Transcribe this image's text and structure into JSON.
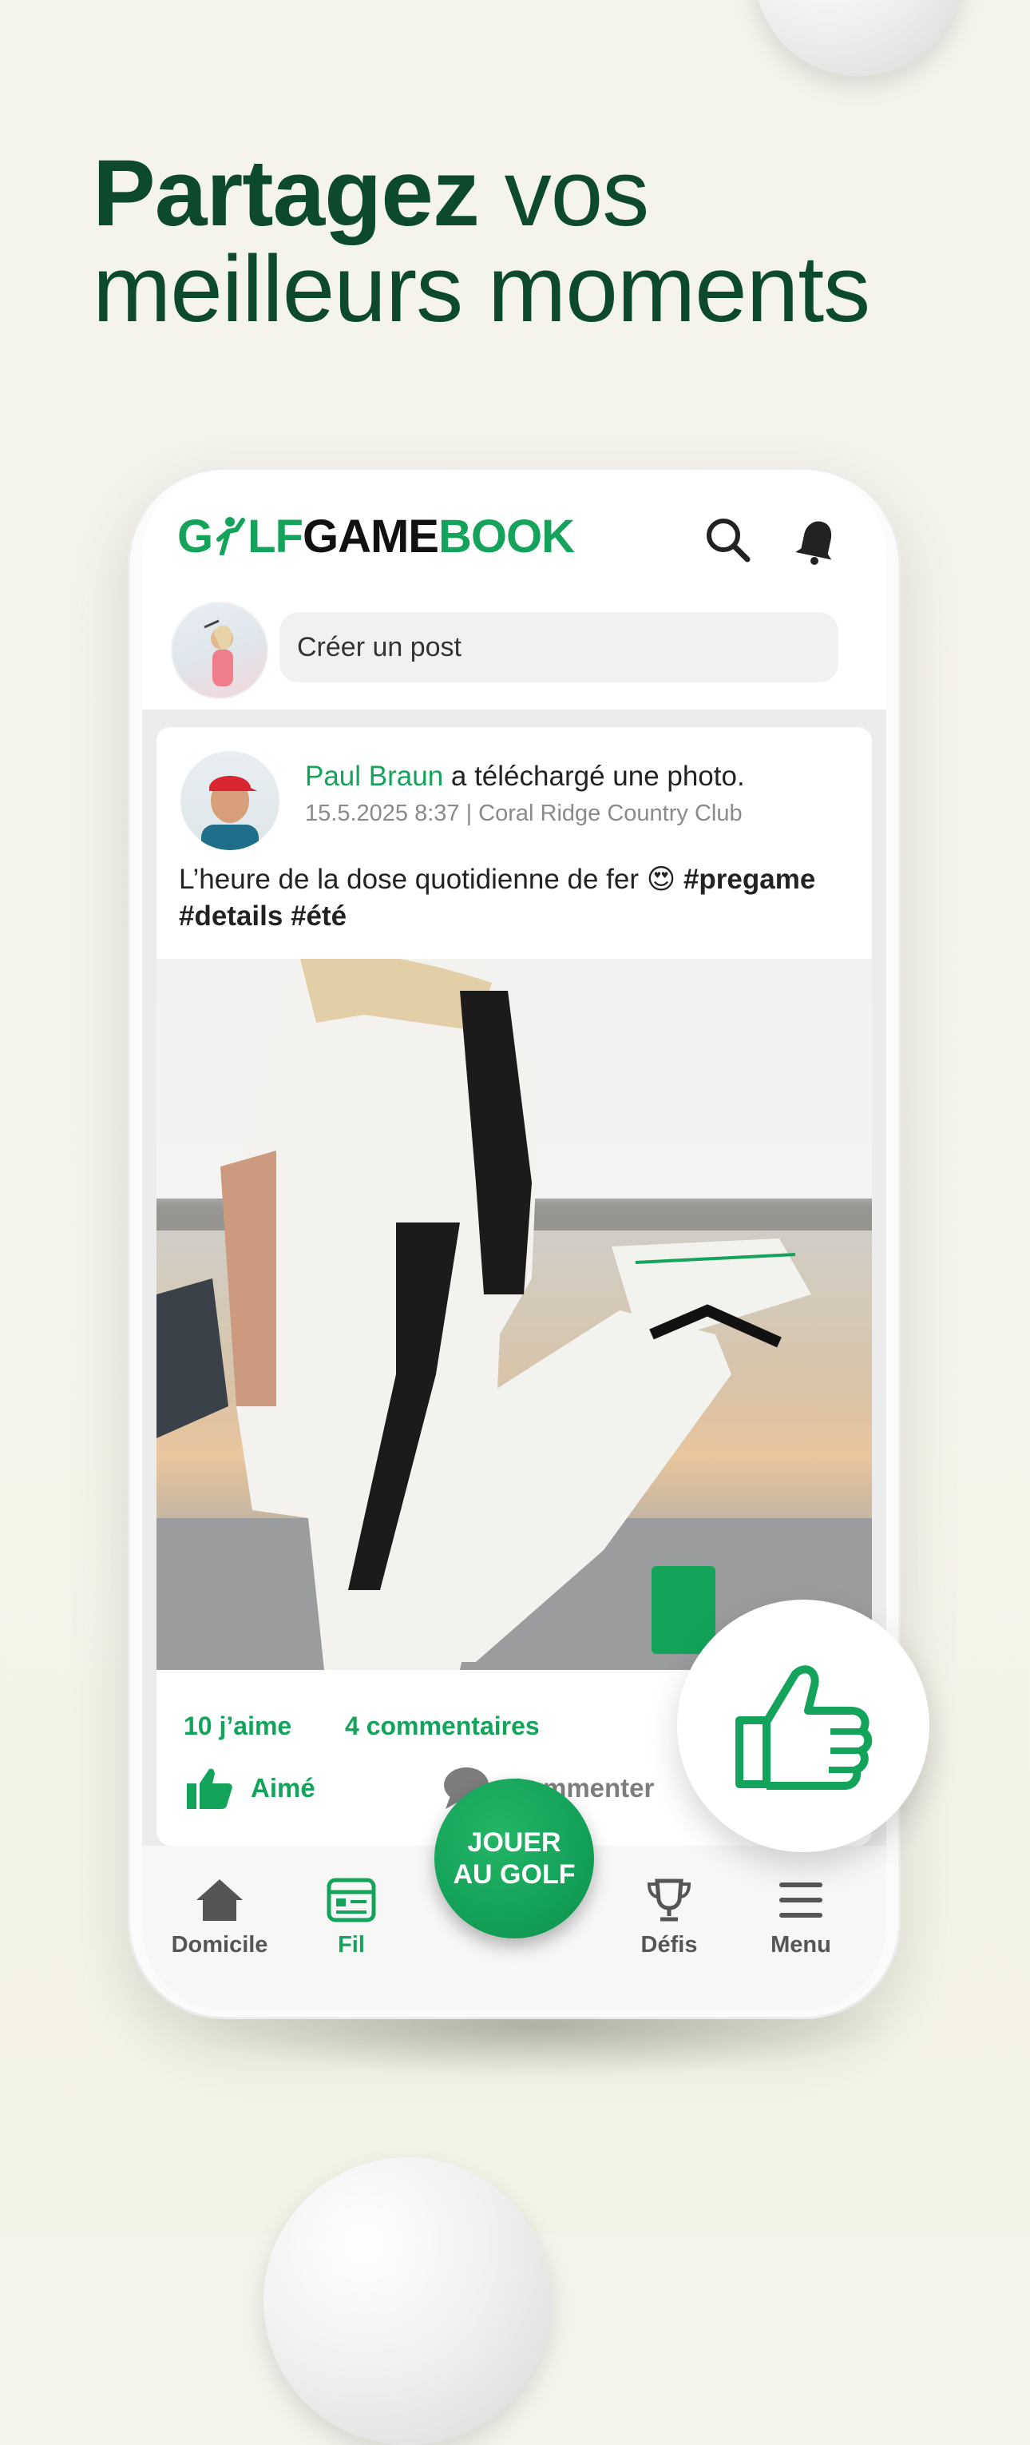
{
  "headline": {
    "bold": "Partagez",
    "rest_line1": " vos",
    "line2": "meilleurs moments"
  },
  "app": {
    "logo": {
      "part1": "G",
      "part1b": "LF",
      "part2": "GAME",
      "part3": "BOOK"
    },
    "create_post_placeholder": "Créer un post"
  },
  "post": {
    "author": "Paul Braun",
    "action_text": " a téléchargé une photo.",
    "meta": "15.5.2025 8:37 | Coral Ridge Country Club",
    "text": "L’heure de la dose quotidienne de fer 😍 ",
    "hashtags": "#pregame #details #été",
    "likes_count": "10 j’aime",
    "comments_count": "4 commentaires",
    "like_action": "Aimé",
    "comment_action": "Commenter"
  },
  "nav": {
    "home": "Domicile",
    "feed": "Fil",
    "play_line1": "JOUER",
    "play_line2": "AU GOLF",
    "challenges": "Défis",
    "menu": "Menu"
  },
  "colors": {
    "brand_green": "#14a35a",
    "headline_green": "#0d4a2c",
    "background": "#f4f3ec"
  },
  "icons": [
    "search-icon",
    "bell-icon",
    "thumbs-up-icon",
    "comment-icon",
    "home-icon",
    "feed-icon",
    "trophy-icon",
    "menu-icon"
  ]
}
